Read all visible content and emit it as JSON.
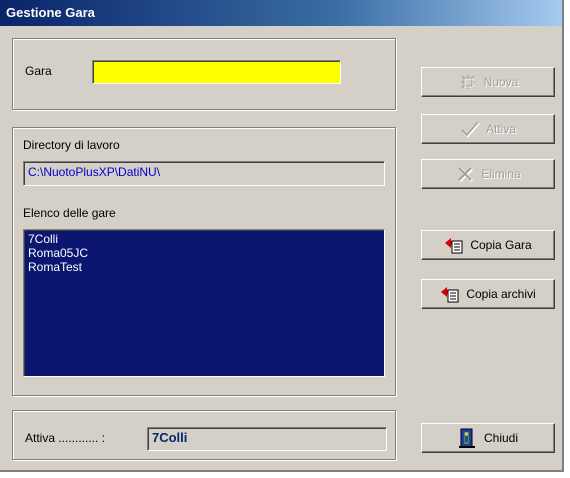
{
  "window": {
    "title": "Gestione Gara"
  },
  "gara": {
    "label": "Gara",
    "value": ""
  },
  "directory": {
    "label": "Directory di lavoro",
    "value": "C:\\NuotoPlusXP\\DatiNU\\"
  },
  "elenco": {
    "label": "Elenco delle gare",
    "items": [
      "7Colli",
      "Roma05JC",
      "RomaTest"
    ]
  },
  "attiva": {
    "label": "Attiva ............ :",
    "value": "7Colli"
  },
  "buttons": {
    "nuova": "Nuova",
    "attiva": "Attiva",
    "elimina": "Elimina",
    "copia_gara": "Copia Gara",
    "copia_archivi": "Copia archivi",
    "chiudi": "Chiudi"
  },
  "colors": {
    "input_bg": "#ffff00",
    "list_bg": "#0a1670",
    "path_text": "#0000cc"
  },
  "icons": {
    "nuova": "new-doc-icon",
    "attiva": "checkmark-icon",
    "elimina": "delete-x-icon",
    "copia_gara": "copy-icon",
    "copia_archivi": "copy-icon",
    "chiudi": "exit-door-icon"
  }
}
